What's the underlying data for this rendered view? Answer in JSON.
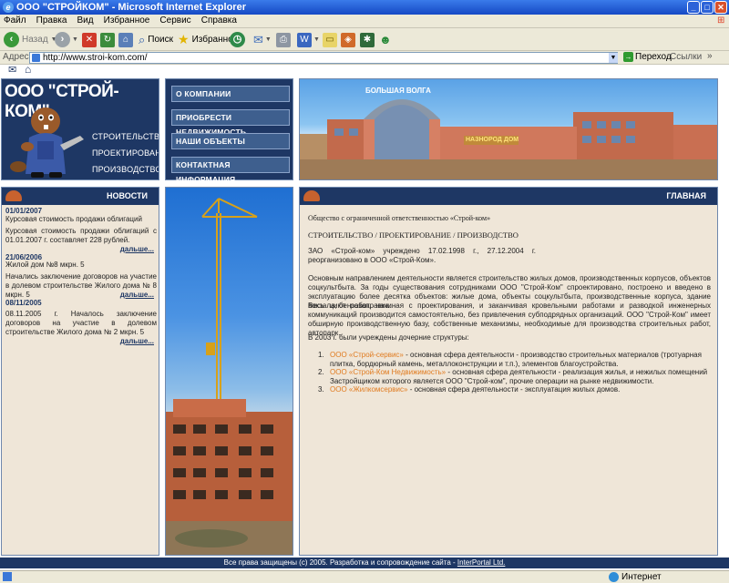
{
  "window": {
    "title": "ООО \"СТРОЙКОМ\" - Microsoft Internet Explorer"
  },
  "menu": [
    "Файл",
    "Правка",
    "Вид",
    "Избранное",
    "Сервис",
    "Справка"
  ],
  "toolbar": {
    "back": "Назад",
    "search": "Поиск",
    "favorites": "Избранное"
  },
  "address": {
    "label": "Адрес",
    "url": "http://www.stroi-kom.com/",
    "go": "Переход",
    "links": "Ссылки"
  },
  "site": {
    "logo_title": "ООО \"СТРОЙ-КОМ\"",
    "services": [
      "СТРОИТЕЛЬСТВО",
      "ПРОЕКТИРОВАНИЕ",
      "ПРОИЗВОДСТВО"
    ],
    "nav": [
      "О КОМПАНИИ",
      "ПРИОБРЕСТИ НЕДВИЖИМОСТЬ",
      "НАШИ ОБЪЕКТЫ",
      "КОНТАКТНАЯ ИНФОРМАЦИЯ"
    ],
    "banner": {
      "sign1": "БОЛЬШАЯ ВОЛГА",
      "sign2": "НАЗНОРОД ДОМ"
    },
    "news": {
      "heading": "НОВОСТИ",
      "more": "дальше...",
      "items": [
        {
          "date": "01/01/2007",
          "title": "Курсовая стоимость продажи облигаций",
          "text": "Курсовая стоимость продажи облигаций с 01.01.2007 г. составляет 228 рублей."
        },
        {
          "date": "21/06/2006",
          "title": "Жилой дом №8 мкрн. 5",
          "text": "Начались заключение договоров на участие в долевом строительстве Жилого дома № 8 мкрн. 5"
        },
        {
          "date": "08/11/2005",
          "title": "",
          "text": "08.11.2005 г. Началось заключение договоров на участие в долевом строительстве Жилого дома № 2 мкрн. 5"
        }
      ]
    },
    "main": {
      "heading": "ГЛАВНАЯ",
      "company": "Общество с ограниченной ответственностью «Строй-ком»",
      "tagline": "СТРОИТЕЛЬСТВО / ПРОЕКТИРОВАНИЕ / ПРОИЗВОДСТВО",
      "p1": "ЗАО «Строй-ком» учреждено 17.02.1998 г., 27.12.2004 г. реорганизовано в ООО «Строй-Ком».",
      "p2": "Основным направлением деятельности является строительство жилых домов, производственных корпусов, объектов соцкультбыта. За годы существования сотрудниками ООО \"Строй-Ком\" спроектировано, построено и введено в эксплуатацию более десятка объектов: жилые дома, объекты соцкультбыта, производственные корпуса, здание вокзала, бензозаправка.",
      "p3": "Весь цикл работ, начиная с проектирования, и заканчивая кровельными работами и разводкой инженерных коммуникаций производится самостоятельно, без привлечения субподрядных организаций. ООО \"Строй-Ком\" имеет обширную производственную базу, собственные механизмы, необходимые для производства строительных работ, автопарк.",
      "p4": "В 2003 г. были учреждены дочерние структуры:",
      "subs": [
        {
          "num": "1.",
          "name": "ООО «Строй-сервис»",
          "desc": " - основная сфера деятельности - производство строительных материалов (тротуарная плитка, бордюрный камень, металлоконструкции и т.п.), элементов благоустройства."
        },
        {
          "num": "2.",
          "name": "ООО «Строй-Ком Недвижимость»",
          "desc": " - основная сфера деятельности - реализация жилья, и нежилых помещений Застройщиком которого является ООО \"Строй-ком\", прочие операции на рынке недвижимости."
        },
        {
          "num": "3.",
          "name": "ООО «Жилкомсервис»",
          "desc": " - основная сфера деятельности - эксплуатация жилых домов."
        }
      ]
    },
    "footer": {
      "text": "Все права защищены (c) 2005. Разработка и сопровождение сайта - ",
      "link": "InterPortal Ltd."
    }
  },
  "status": {
    "zone": "Интернет"
  },
  "colors": {
    "navy": "#1e3764",
    "panel": "#efe6d8",
    "accent": "#e07a1e"
  }
}
